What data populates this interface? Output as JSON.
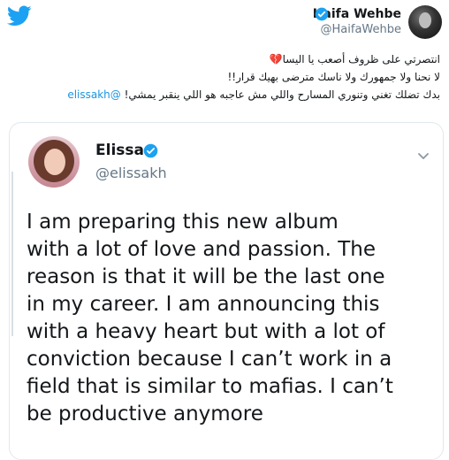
{
  "header": {
    "author_name": "Haifa Wehbe",
    "author_handle": "@HaifaWehbe",
    "icons": [
      "twitter-bird-icon",
      "verified-badge-icon",
      "avatar"
    ]
  },
  "tweet": {
    "lines": [
      "انتصرتي على ظروف أصعب يا اليسا💔",
      "لا نحنا ولا جمهورك ولا ناسك مترضى بهيك قرار!!",
      "بدك تضلك تغني وتنوري المسارح  واللي مش عاجبه هو اللي ينقبر يمشي!",
      "@elissakh"
    ]
  },
  "quoted": {
    "name": "Elissa",
    "handle": "@elissakh",
    "body_lines": [
      "I am preparing this new album",
      "with a lot of love and passion. The",
      "reason is that it will be the last one",
      "in my career. I am announcing this",
      "with a heavy heart but with a lot of",
      "conviction because I can’t work in a",
      "field that is similar to mafias. I can’t",
      "be productive anymore"
    ]
  },
  "colors": {
    "twitter_blue": "#1da1f2",
    "link_blue": "#1b95e0",
    "text_primary": "#14171a",
    "text_secondary": "#657786",
    "border": "#e1e8ed"
  }
}
